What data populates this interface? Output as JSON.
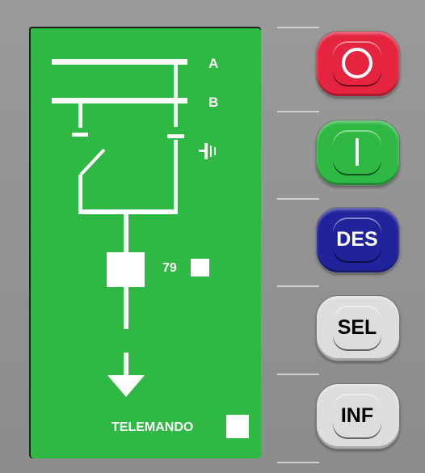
{
  "mimic": {
    "busbar_a_label": "A",
    "busbar_b_label": "B",
    "recloser_label": "79",
    "remote_label": "TELEMANDO",
    "recloser_indicator_on": false,
    "remote_indicator_on": false
  },
  "buttons": {
    "open_symbol": "O",
    "close_symbol": "I",
    "des_label": "DES",
    "sel_label": "SEL",
    "inf_label": "INF"
  },
  "colors": {
    "screen": "#2fb844",
    "open_button": "#e5243f",
    "close_button": "#2fb844",
    "des_button": "#20239a",
    "neutral_button": "#dddddd",
    "panel": "#8f8f8f"
  }
}
